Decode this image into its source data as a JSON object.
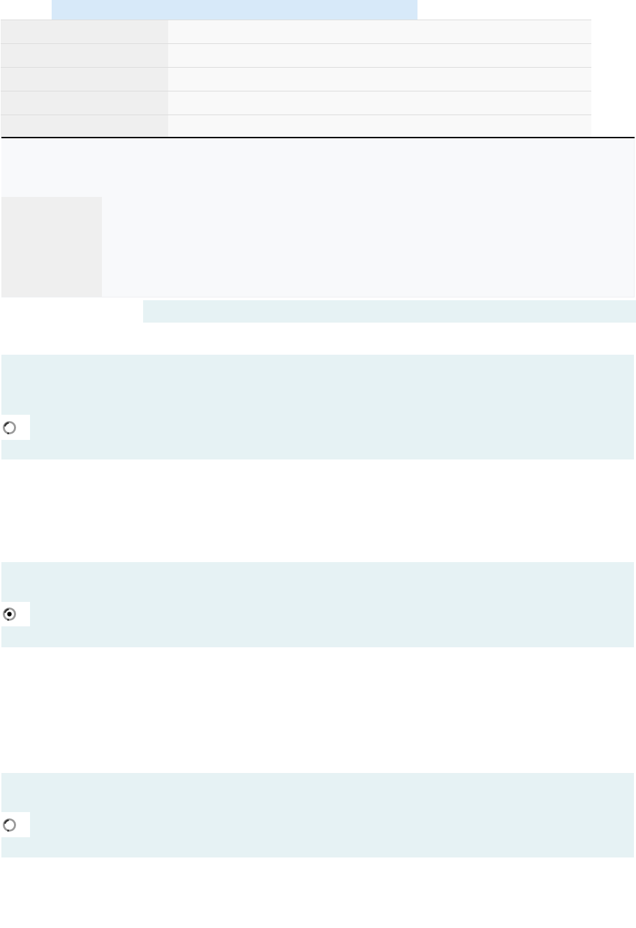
{
  "options": [
    {
      "selected": false
    },
    {
      "selected": true
    },
    {
      "selected": false
    }
  ]
}
